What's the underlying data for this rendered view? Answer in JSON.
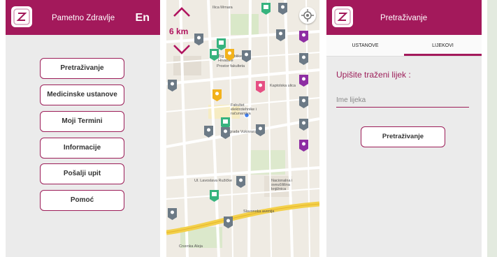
{
  "home": {
    "title": "Pametno Zdravlje",
    "lang": "En",
    "menu": [
      "Pretraživanje",
      "Medicinske ustanove",
      "Moji Termini",
      "Informacije",
      "Pošalji upit",
      "Pomoć"
    ]
  },
  "map": {
    "distance": "6 km",
    "labels": [
      "Ilica Mrnara",
      "Trg Republike Hrvatske",
      "Prostor fakulteta",
      "Fakultet elektrotehnike i računarstva",
      "Ul. grada Vukovara",
      "Ul. Lavoslava Ružičke",
      "Nacionalna i sveučilišna knjižnica",
      "Slavonska avenija",
      "Kaptolska ulica",
      "Crvenka Aleja"
    ]
  },
  "search": {
    "title": "Pretraživanje",
    "tabs": [
      "USTANOVE",
      "LIJEKOVI"
    ],
    "active_tab": "LIJEKOVI",
    "label": "Upišite traženi lijek :",
    "input_placeholder": "Ime lijeka",
    "input_value": "",
    "button": "Pretraživanje"
  },
  "colors": {
    "brand": "#a3195b",
    "pin_green": "#36b37e",
    "pin_purple": "#8e2ea3",
    "pin_grey": "#6c7a86",
    "pin_yellow": "#f2b21c",
    "pin_pink": "#e64f83",
    "road_yellow": "#f3d04a"
  }
}
